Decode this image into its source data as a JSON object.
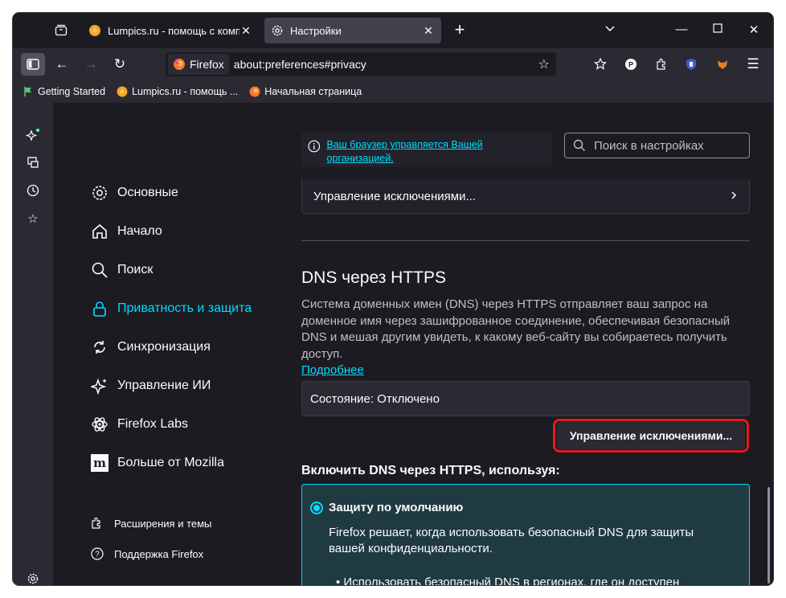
{
  "tabs": [
    {
      "title": "Lumpics.ru - помощь с компью",
      "active": false,
      "favicon": "lumpics-orange-icon"
    },
    {
      "title": "Настройки",
      "active": true,
      "favicon": "gear-icon"
    }
  ],
  "navbar": {
    "identity_label": "Firefox",
    "url": "about:preferences#privacy"
  },
  "bookmarks": [
    {
      "label": "Getting Started",
      "icon": "getting-started-icon"
    },
    {
      "label": "Lumpics.ru - помощь ...",
      "icon": "lumpics-orange-icon"
    },
    {
      "label": "Начальная страница",
      "icon": "firefox-icon"
    }
  ],
  "categories": [
    {
      "label": "Основные",
      "icon": "gear-icon"
    },
    {
      "label": "Начало",
      "icon": "home-icon"
    },
    {
      "label": "Поиск",
      "icon": "search-icon"
    },
    {
      "label": "Приватность и защита",
      "icon": "lock-icon",
      "selected": true
    },
    {
      "label": "Синхронизация",
      "icon": "sync-icon"
    },
    {
      "label": "Управление ИИ",
      "icon": "sparkle-icon"
    },
    {
      "label": "Firefox Labs",
      "icon": "atom-icon"
    },
    {
      "label": "Больше от Mozilla",
      "icon": "mozilla-icon"
    }
  ],
  "footer_links": [
    {
      "label": "Расширения и темы",
      "icon": "puzzle-icon"
    },
    {
      "label": "Поддержка Firefox",
      "icon": "help-icon"
    }
  ],
  "policy_notice": "Ваш браузер управляется Вашей организацией.",
  "search_placeholder": "Поиск в настройках",
  "exceptions_row": "Управление исключениями...",
  "dns": {
    "heading": "DNS через HTTPS",
    "description": "Система доменных имен (DNS) через HTTPS отправляет ваш запрос на доменное имя через зашифрованное соединение, обеспечивая безопасный DNS и мешая другим увидеть, к какому веб-сайту вы собираетесь получить доступ.",
    "learn_more": "Подробнее",
    "status": "Состояние: Отключено",
    "manage_button": "Управление исключениями...",
    "enable_heading": "Включить DNS через HTTPS, используя:",
    "option_default": {
      "label": "Защиту по умолчанию",
      "description": "Firefox решает, когда использовать безопасный DNS для защиты вашей конфиденциальности.",
      "bullet": "Использовать безопасный DNS в регионах, где он доступен"
    }
  },
  "colors": {
    "accent": "#00ddff",
    "highlight": "#e8161e",
    "background": "#1c1b22"
  }
}
